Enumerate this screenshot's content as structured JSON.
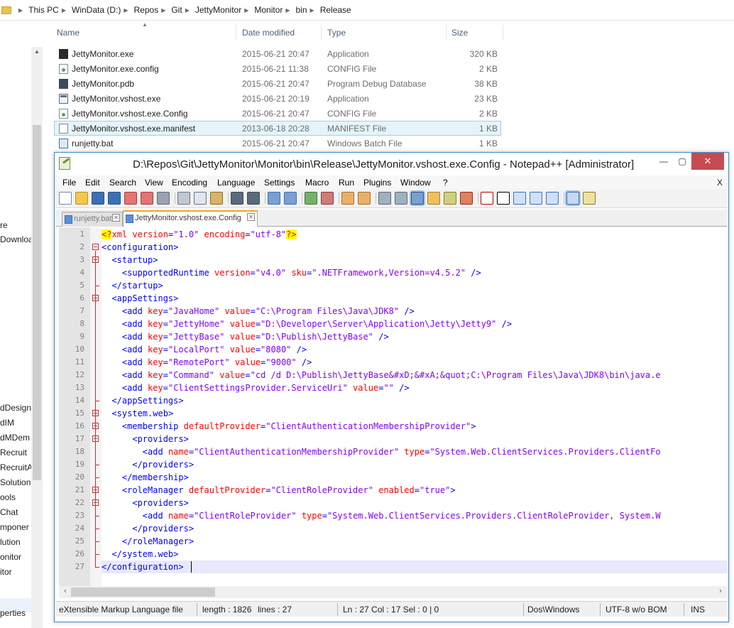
{
  "explorer": {
    "breadcrumb": [
      "This PC",
      "WinData (D:)",
      "Repos",
      "Git",
      "JettyMonitor",
      "Monitor",
      "bin",
      "Release"
    ],
    "columns": {
      "name": "Name",
      "date": "Date modified",
      "type": "Type",
      "size": "Size"
    },
    "files": [
      {
        "name": "JettyMonitor.exe",
        "date": "2015-06-21 20:47",
        "type": "Application",
        "size": "320 KB",
        "icon": "exe-icon"
      },
      {
        "name": "JettyMonitor.exe.config",
        "date": "2015-06-21 11:38",
        "type": "CONFIG File",
        "size": "2 KB",
        "icon": "config-file-icon"
      },
      {
        "name": "JettyMonitor.pdb",
        "date": "2015-06-21 20:47",
        "type": "Program Debug Database",
        "size": "38 KB",
        "icon": "pdb-file-icon"
      },
      {
        "name": "JettyMonitor.vshost.exe",
        "date": "2015-06-21 20:19",
        "type": "Application",
        "size": "23 KB",
        "icon": "application-icon"
      },
      {
        "name": "JettyMonitor.vshost.exe.Config",
        "date": "2015-06-21 20:47",
        "type": "CONFIG File",
        "size": "2 KB",
        "icon": "config-file-icon"
      },
      {
        "name": "JettyMonitor.vshost.exe.manifest",
        "date": "2013-06-18 20:28",
        "type": "MANIFEST File",
        "size": "1 KB",
        "icon": "manifest-file-icon"
      },
      {
        "name": "runjetty.bat",
        "date": "2015-06-21 20:47",
        "type": "Windows Batch File",
        "size": "1 KB",
        "icon": "batch-file-icon"
      }
    ],
    "nav_items": [
      "re",
      "Downloa",
      "dDesign",
      "dIM",
      "dMDem",
      "Recruit",
      "RecruitAı",
      "Solution",
      "ools",
      "Chat",
      "mponer",
      "lution",
      "onitor",
      "itor",
      "perties"
    ]
  },
  "notepad": {
    "title": "D:\\Repos\\Git\\JettyMonitor\\Monitor\\bin\\Release\\JettyMonitor.vshost.exe.Config - Notepad++ [Administrator]",
    "window_buttons": {
      "minimize": "—",
      "maximize": "▢",
      "close": "✕"
    },
    "menu": [
      "File",
      "Edit",
      "Search",
      "View",
      "Encoding",
      "Language",
      "Settings",
      "Macro",
      "Run",
      "Plugins",
      "Window",
      "?"
    ],
    "menu_close": "X",
    "tabs": [
      {
        "label": "runjetty.bat",
        "active": false
      },
      {
        "label": "JettyMonitor.vshost.exe.Config",
        "active": true
      }
    ],
    "line_numbers": [
      "1",
      "2",
      "3",
      "4",
      "5",
      "6",
      "7",
      "8",
      "9",
      "10",
      "11",
      "12",
      "13",
      "14",
      "15",
      "16",
      "17",
      "18",
      "19",
      "20",
      "21",
      "22",
      "23",
      "24",
      "25",
      "26",
      "27"
    ],
    "code": [
      "<?xml version=\"1.0\" encoding=\"utf-8\"?>",
      "<configuration>",
      "  <startup>",
      "    <supportedRuntime version=\"v4.0\" sku=\".NETFramework,Version=v4.5.2\" />",
      "  </startup>",
      "  <appSettings>",
      "    <add key=\"JavaHome\" value=\"C:\\Program Files\\Java\\JDK8\" />",
      "    <add key=\"JettyHome\" value=\"D:\\Developer\\Server\\Application\\Jetty\\Jetty9\" />",
      "    <add key=\"JettyBase\" value=\"D:\\Publish\\JettyBase\" />",
      "    <add key=\"LocalPort\" value=\"8080\" />",
      "    <add key=\"RemotePort\" value=\"9000\" />",
      "    <add key=\"Command\" value=\"cd /d D:\\Publish\\JettyBase&#xD;&#xA;&quot;C:\\Program Files\\Java\\JDK8\\bin\\java.e",
      "    <add key=\"ClientSettingsProvider.ServiceUri\" value=\"\" />",
      "  </appSettings>",
      "  <system.web>",
      "    <membership defaultProvider=\"ClientAuthenticationMembershipProvider\">",
      "      <providers>",
      "        <add name=\"ClientAuthenticationMembershipProvider\" type=\"System.Web.ClientServices.Providers.ClientFo",
      "      </providers>",
      "    </membership>",
      "    <roleManager defaultProvider=\"ClientRoleProvider\" enabled=\"true\">",
      "      <providers>",
      "        <add name=\"ClientRoleProvider\" type=\"System.Web.ClientServices.Providers.ClientRoleProvider, System.W",
      "      </providers>",
      "    </roleManager>",
      "  </system.web>",
      "</configuration>"
    ],
    "current_line": 27,
    "status": {
      "file_type": "eXtensible Markup Language file",
      "length": "length : 1826",
      "lines": "lines : 27",
      "position": "Ln : 27    Col : 17    Sel : 0 | 0",
      "eol": "Dos\\Windows",
      "encoding": "UTF-8 w/o BOM",
      "mode": "INS"
    },
    "colors": {
      "tag": "#0000ff",
      "attr": "#ff0000",
      "value": "#8000ff",
      "accent_tab": "#f5a623",
      "close_button": "#c74b50"
    }
  }
}
